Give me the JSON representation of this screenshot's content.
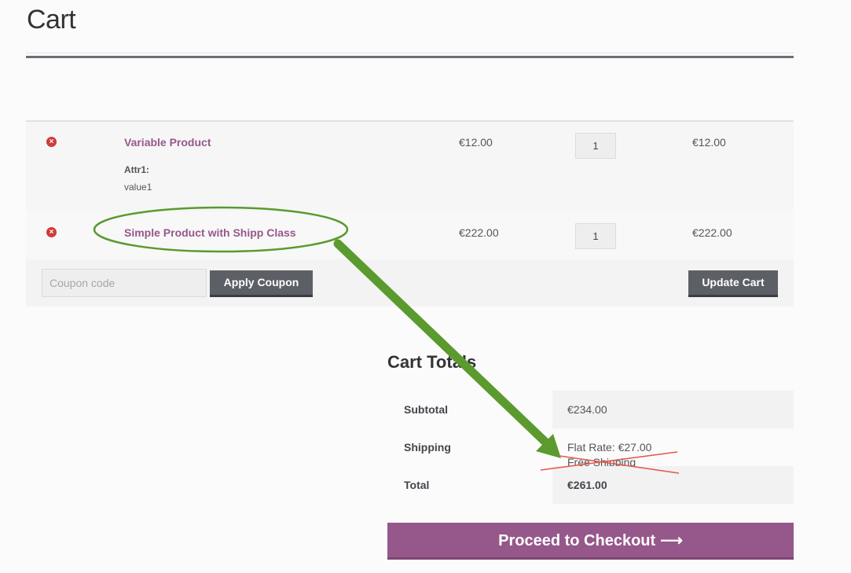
{
  "page": {
    "title": "Cart"
  },
  "cart": {
    "items": [
      {
        "remove_icon": "×",
        "name": "Variable Product",
        "attr_label": "Attr1:",
        "attr_value": "value1",
        "price": "€12.00",
        "quantity": "1",
        "subtotal": "€12.00"
      },
      {
        "remove_icon": "×",
        "name": "Simple Product with Shipp Class",
        "price": "€222.00",
        "quantity": "1",
        "subtotal": "€222.00"
      }
    ],
    "coupon": {
      "placeholder": "Coupon code",
      "apply_label": "Apply Coupon"
    },
    "update_label": "Update Cart"
  },
  "totals": {
    "heading": "Cart Totals",
    "subtotal_label": "Subtotal",
    "subtotal_value": "€234.00",
    "shipping_label": "Shipping",
    "shipping_line1": "Flat Rate: €27.00",
    "shipping_line2": "Free Shipping",
    "total_label": "Total",
    "total_value": "€261.00"
  },
  "checkout": {
    "label": "Proceed to Checkout",
    "arrow": "⟶"
  },
  "annotations": {
    "ellipse_color": "#5a9a2e",
    "arrow_color": "#5a9a2e",
    "strike_color": "#e05a4f"
  }
}
